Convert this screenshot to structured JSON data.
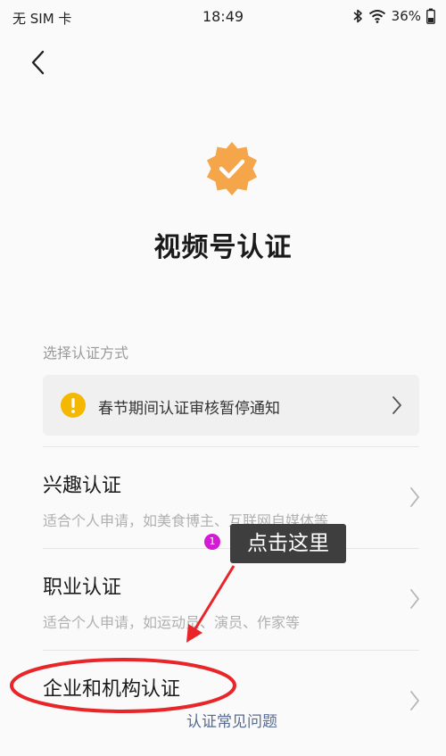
{
  "status_bar": {
    "carrier": "无 SIM 卡",
    "time": "18:49",
    "battery": "36%",
    "icons": [
      "bluetooth-icon",
      "wifi-icon",
      "battery-icon"
    ]
  },
  "header": {
    "back_icon": "chevron-left-icon"
  },
  "verification": {
    "badge_icon": "verified-badge-icon",
    "badge_color": "#f5a54a",
    "title": "视频号认证"
  },
  "section_label": "选择认证方式",
  "notice": {
    "icon": "warning-icon",
    "icon_color": "#f5b800",
    "text": "春节期间认证审核暂停通知"
  },
  "options": [
    {
      "title": "兴趣认证",
      "description": "适合个人申请，如美食博主、互联网自媒体等"
    },
    {
      "title": "职业认证",
      "description": "适合个人申请，如运动员、演员、作家等"
    },
    {
      "title": "企业和机构认证",
      "description": ""
    }
  ],
  "annotation": {
    "step_number": "1",
    "step_color": "#d31bd3",
    "tooltip": "点击这里",
    "highlight_color": "#e8262a"
  },
  "footer": {
    "faq_link": "认证常见问题"
  }
}
